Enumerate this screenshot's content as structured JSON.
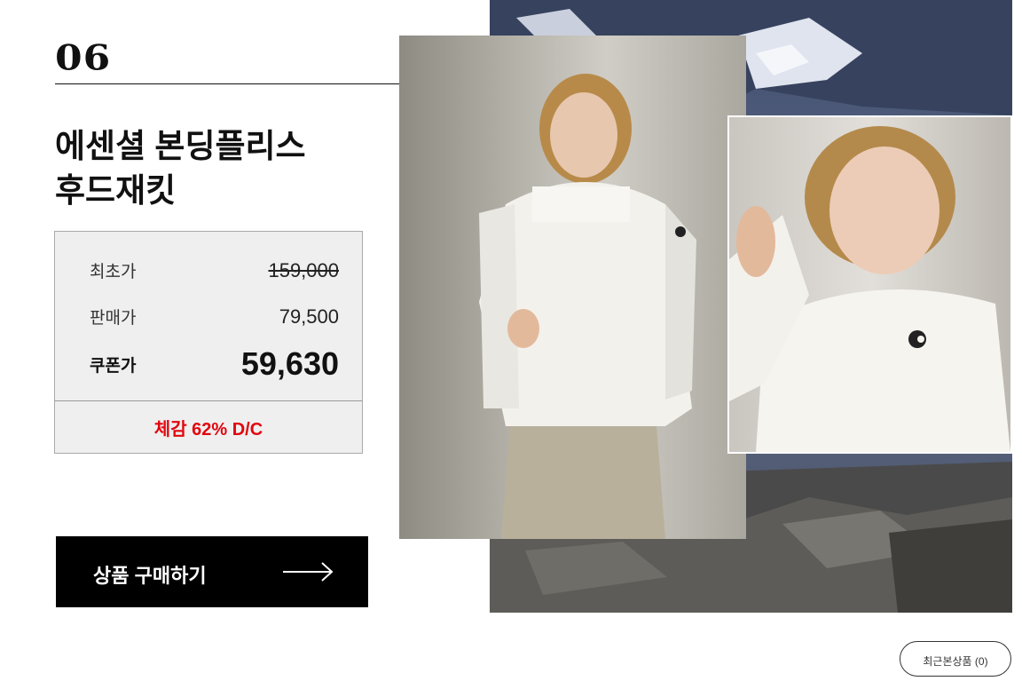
{
  "product": {
    "number": "06",
    "title_line1": "에센셜 본딩플리스",
    "title_line2": "후드재킷"
  },
  "pricing": {
    "original_label": "최초가",
    "original_price": "159,000",
    "sale_label": "판매가",
    "sale_price": "79,500",
    "coupon_label": "쿠폰가",
    "coupon_price": "59,630",
    "discount_text": "체감 62% D/C"
  },
  "cta": {
    "buy_label": "상품 구매하기"
  },
  "recent": {
    "label": "최근본상품 (0)"
  },
  "colors": {
    "discount": "#e1060f",
    "button_bg": "#000000"
  }
}
